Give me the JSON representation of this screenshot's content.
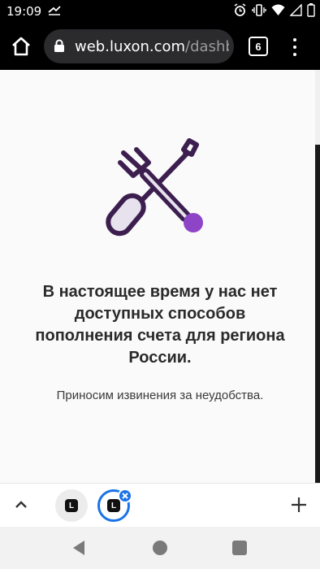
{
  "status_bar": {
    "time": "19:09",
    "icons": [
      "transfer-icon",
      "alarm-icon",
      "vibrate-icon",
      "wifi-icon",
      "signal-icon",
      "battery-icon"
    ]
  },
  "browser": {
    "url_host": "web.luxon.com",
    "url_path": "/dashboa",
    "tab_count": "6",
    "icons": [
      "home-icon",
      "lock-icon",
      "tabs-icon",
      "menu-icon"
    ]
  },
  "page": {
    "heading": "В настоящее время у нас нет доступных способов пополнения счета для региона России.",
    "subtext": "Приносим извинения за неудобства.",
    "illustration": "tools-icon",
    "colors": {
      "tool_dark": "#3c1f4f",
      "tool_light": "#e7e2ee",
      "accent": "#8e44c7"
    }
  },
  "tab_strip": {
    "tabs": [
      {
        "favicon": "L"
      },
      {
        "favicon": "L"
      }
    ],
    "icons": [
      "chevron-up-icon",
      "close-icon",
      "plus-icon"
    ],
    "active_color": "#1a73e8"
  },
  "navbar": {
    "icons": [
      "back-icon",
      "home-circle-icon",
      "recents-icon"
    ]
  }
}
